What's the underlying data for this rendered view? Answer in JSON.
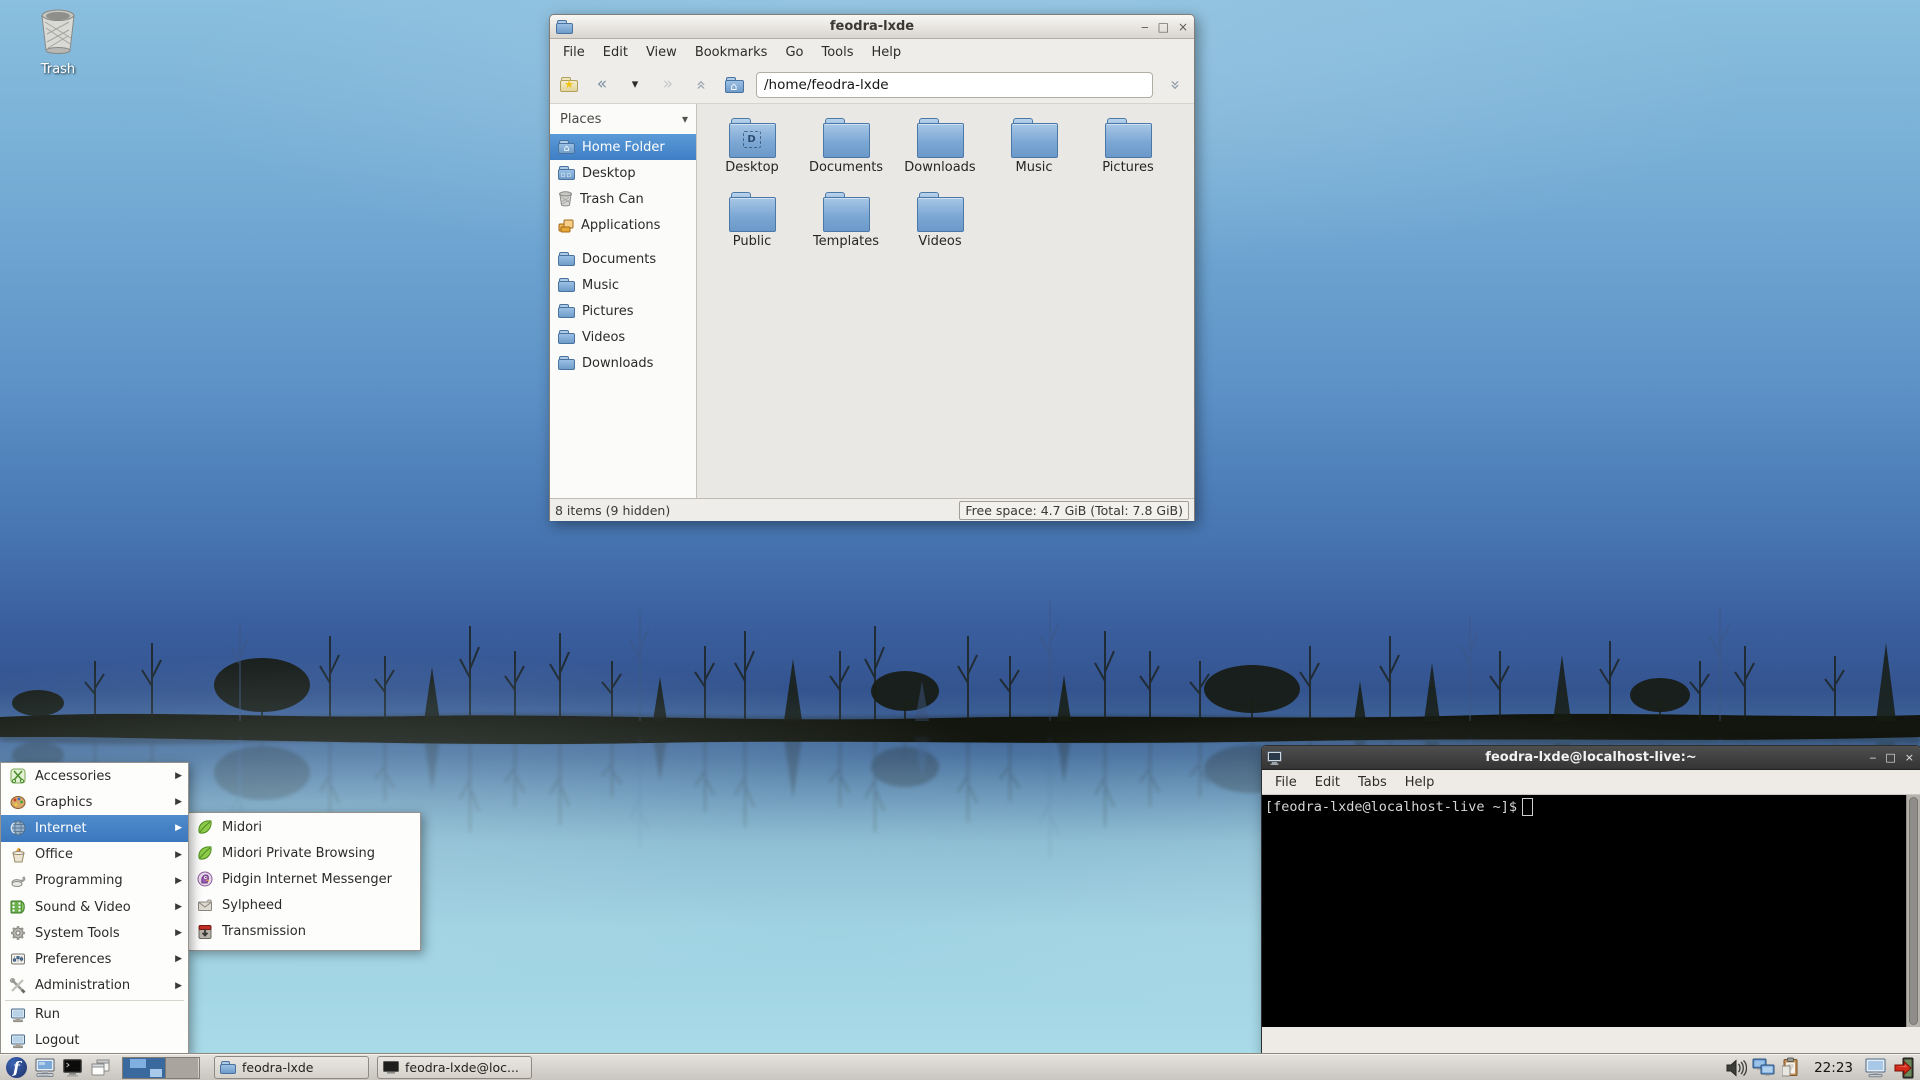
{
  "desktop": {
    "trash_label": "Trash"
  },
  "colors": {
    "selection_blue": "#3f7ec4",
    "fedora_blue": "#294172",
    "folder_blue": "#7ca7d4",
    "terminal_bg": "#000000",
    "taskbar_bg": "#d5d1ca"
  },
  "glyphs": {
    "minimize": "‒",
    "maximize": "□",
    "close": "×",
    "back": "«",
    "forward": "»",
    "caret": "▾",
    "submenu_arrow": "▶",
    "places_chevron": "▾",
    "home": "⌂",
    "star": "★"
  },
  "file_manager": {
    "title": "feodra-lxde",
    "menu": [
      "File",
      "Edit",
      "View",
      "Bookmarks",
      "Go",
      "Tools",
      "Help"
    ],
    "toolbar": {
      "path": "/home/feodra-lxde",
      "icons": [
        "new-tab",
        "back",
        "history-dropdown",
        "forward",
        "up",
        "home",
        "jump-to-path"
      ]
    },
    "places": {
      "header": "Places",
      "items": [
        {
          "label": "Home Folder",
          "icon": "home-folder",
          "selected": true
        },
        {
          "label": "Desktop",
          "icon": "desktop-folder",
          "selected": false
        },
        {
          "label": "Trash Can",
          "icon": "trash-can",
          "selected": false
        },
        {
          "label": "Applications",
          "icon": "applications",
          "selected": false
        },
        {
          "label": "Documents",
          "icon": "folder",
          "selected": false
        },
        {
          "label": "Music",
          "icon": "folder",
          "selected": false
        },
        {
          "label": "Pictures",
          "icon": "folder",
          "selected": false
        },
        {
          "label": "Videos",
          "icon": "folder",
          "selected": false
        },
        {
          "label": "Downloads",
          "icon": "folder",
          "selected": false
        }
      ]
    },
    "folders": [
      "Desktop",
      "Documents",
      "Downloads",
      "Music",
      "Pictures",
      "Public",
      "Templates",
      "Videos"
    ],
    "statusbar": {
      "items": "8 items (9 hidden)",
      "free_space": "Free space: 4.7 GiB (Total: 7.8 GiB)"
    }
  },
  "start_menu": {
    "items": [
      {
        "label": "Accessories",
        "icon": "accessories",
        "has_submenu": true,
        "selected": false
      },
      {
        "label": "Graphics",
        "icon": "graphics",
        "has_submenu": true,
        "selected": false
      },
      {
        "label": "Internet",
        "icon": "internet",
        "has_submenu": true,
        "selected": true
      },
      {
        "label": "Office",
        "icon": "office",
        "has_submenu": true,
        "selected": false
      },
      {
        "label": "Programming",
        "icon": "programming",
        "has_submenu": true,
        "selected": false
      },
      {
        "label": "Sound & Video",
        "icon": "sound-video",
        "has_submenu": true,
        "selected": false
      },
      {
        "label": "System Tools",
        "icon": "system-tools",
        "has_submenu": true,
        "selected": false
      },
      {
        "label": "Preferences",
        "icon": "preferences",
        "has_submenu": true,
        "selected": false
      },
      {
        "label": "Administration",
        "icon": "administration",
        "has_submenu": true,
        "selected": false
      },
      {
        "label": "Run",
        "icon": "run",
        "has_submenu": false,
        "selected": false
      },
      {
        "label": "Logout",
        "icon": "logout",
        "has_submenu": false,
        "selected": false
      }
    ]
  },
  "internet_submenu": {
    "items": [
      {
        "label": "Midori",
        "icon": "midori"
      },
      {
        "label": "Midori Private Browsing",
        "icon": "midori"
      },
      {
        "label": "Pidgin Internet Messenger",
        "icon": "pidgin"
      },
      {
        "label": "Sylpheed",
        "icon": "sylpheed"
      },
      {
        "label": "Transmission",
        "icon": "transmission"
      }
    ]
  },
  "terminal": {
    "title": "feodra-lxde@localhost-live:~",
    "menu": [
      "File",
      "Edit",
      "Tabs",
      "Help"
    ],
    "prompt": "[feodra-lxde@localhost-live ~]$"
  },
  "taskbar": {
    "launchers": [
      "start-menu",
      "file-manager",
      "terminal",
      "minimize-all"
    ],
    "pager_workspaces": 2,
    "tasks": [
      {
        "label": "feodra-lxde",
        "icon": "folder"
      },
      {
        "label": "feodra-lxde@loc...",
        "icon": "terminal"
      }
    ],
    "tray": [
      "volume",
      "network",
      "clipboard",
      "screen-lock",
      "quit"
    ],
    "clock": "22:23"
  }
}
